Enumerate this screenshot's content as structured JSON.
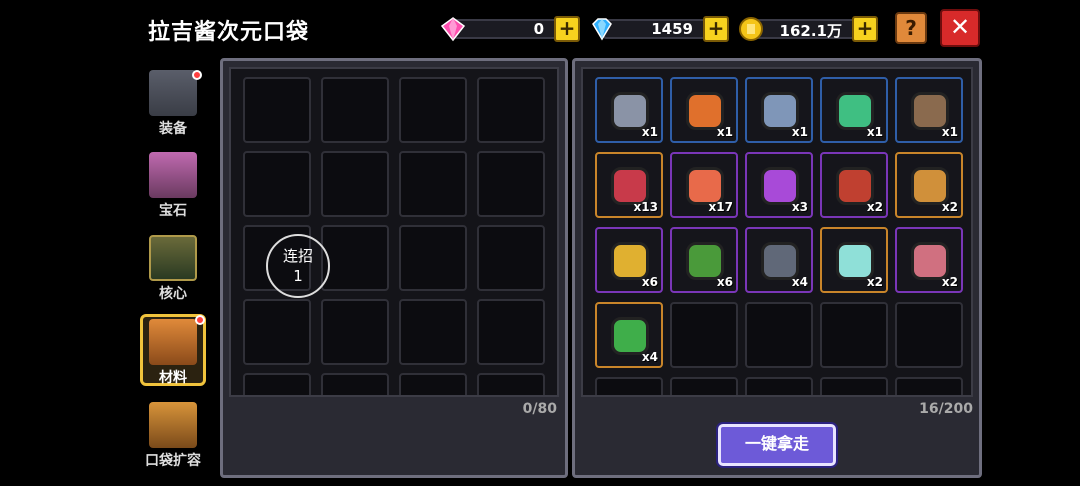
{
  "header": {
    "title": "拉吉酱次元口袋"
  },
  "currency": {
    "pink_gem": "0",
    "blue_diamond": "1459",
    "gold": "162.1万",
    "plus": "+"
  },
  "buttons": {
    "help": "?",
    "close": "✕",
    "take_all": "一键拿走"
  },
  "sidebar": [
    {
      "label": "装备",
      "has_dot": true
    },
    {
      "label": "宝石",
      "has_dot": false
    },
    {
      "label": "核心",
      "has_dot": false
    },
    {
      "label": "材料",
      "has_dot": true,
      "active": true
    },
    {
      "label": "口袋扩容",
      "has_dot": false
    }
  ],
  "left_panel": {
    "combo_label": "连招",
    "combo_value": "1",
    "capacity": "0/80"
  },
  "right_panel": {
    "capacity": "16/200",
    "items": [
      {
        "name": "blue-plank-icon",
        "rarity": "blue",
        "qty": "x1",
        "color": "#8a93a6"
      },
      {
        "name": "orange-ore-icon",
        "rarity": "blue",
        "qty": "x1",
        "color": "#e0702c"
      },
      {
        "name": "steel-loop-icon",
        "rarity": "blue",
        "qty": "x1",
        "color": "#7f96b8"
      },
      {
        "name": "green-crystal-icon",
        "rarity": "blue",
        "qty": "x1",
        "color": "#3fbf82"
      },
      {
        "name": "brown-book-icon",
        "rarity": "blue",
        "qty": "x1",
        "color": "#8a6a4e"
      },
      {
        "name": "red-crystal-cluster-icon",
        "rarity": "orange",
        "qty": "x13",
        "color": "#c83a4a"
      },
      {
        "name": "red-rod-orb-icon",
        "rarity": "purple",
        "qty": "x17",
        "color": "#e86a4a"
      },
      {
        "name": "purple-flask-orb-icon",
        "rarity": "purple",
        "qty": "x3",
        "color": "#a84ad8"
      },
      {
        "name": "red-bowl-icon",
        "rarity": "purple",
        "qty": "x2",
        "color": "#c04030"
      },
      {
        "name": "pickaxe-icon",
        "rarity": "orange",
        "qty": "x2",
        "color": "#d0903a"
      },
      {
        "name": "golden-bell-icon",
        "rarity": "purple",
        "qty": "x6",
        "color": "#e0b030"
      },
      {
        "name": "cactus-icon",
        "rarity": "purple",
        "qty": "x6",
        "color": "#4a9a3a"
      },
      {
        "name": "chain-rod-icon",
        "rarity": "purple",
        "qty": "x4",
        "color": "#606878"
      },
      {
        "name": "ghost-fish-icon",
        "rarity": "orange",
        "qty": "x2",
        "color": "#8fe0d8"
      },
      {
        "name": "horn-icon",
        "rarity": "purple",
        "qty": "x2",
        "color": "#d07080"
      },
      {
        "name": "green-boot-icon",
        "rarity": "orange",
        "qty": "x4",
        "color": "#3fae4a"
      }
    ]
  }
}
